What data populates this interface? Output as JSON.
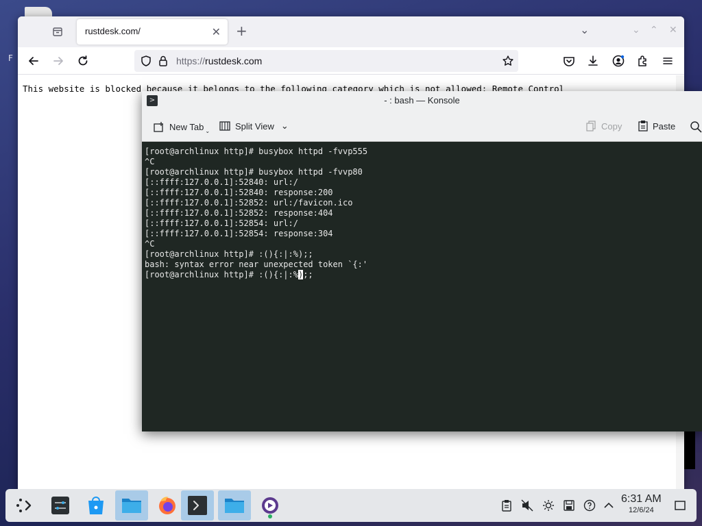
{
  "browser": {
    "tab_title": "rustdesk.com/",
    "url_protocol": "https://",
    "url_host": "rustdesk.com",
    "blocked_message": "This website is blocked because it belongs to the following category which is not allowed: Remote Control"
  },
  "desktop": {
    "partial_label": "F"
  },
  "konsole": {
    "title": "- : bash — Konsole",
    "toolbar": {
      "new_tab": "New Tab",
      "split_view": "Split View",
      "copy": "Copy",
      "paste": "Paste"
    },
    "lines": [
      "[root@archlinux http]# busybox httpd -fvvp555",
      "^C",
      "[root@archlinux http]# busybox httpd -fvvp80",
      "[::ffff:127.0.0.1]:52840: url:/",
      "[::ffff:127.0.0.1]:52840: response:200",
      "[::ffff:127.0.0.1]:52852: url:/favicon.ico",
      "[::ffff:127.0.0.1]:52852: response:404",
      "[::ffff:127.0.0.1]:52854: url:/",
      "[::ffff:127.0.0.1]:52854: response:304",
      "^C",
      "[root@archlinux http]# :(){:|:%);;",
      "bash: syntax error near unexpected token `{:'"
    ],
    "current_line_before_cursor": "[root@archlinux http]# :(){:|:%",
    "cursor_char": ")",
    "current_line_after_cursor": ";;"
  },
  "taskbar": {
    "time": "6:31 AM",
    "date": "12/6/24",
    "items": [
      "application-launcher-icon",
      "system-settings-icon",
      "discover-store-icon",
      "file-manager-icon",
      "firefox-icon",
      "konsole-icon",
      "file-manager-icon",
      "media-player-icon"
    ]
  },
  "colors": {
    "terminal_bg": "#1f2723",
    "taskbar_active": "#a9cbe8",
    "firefox_orange": "#ff7139"
  }
}
